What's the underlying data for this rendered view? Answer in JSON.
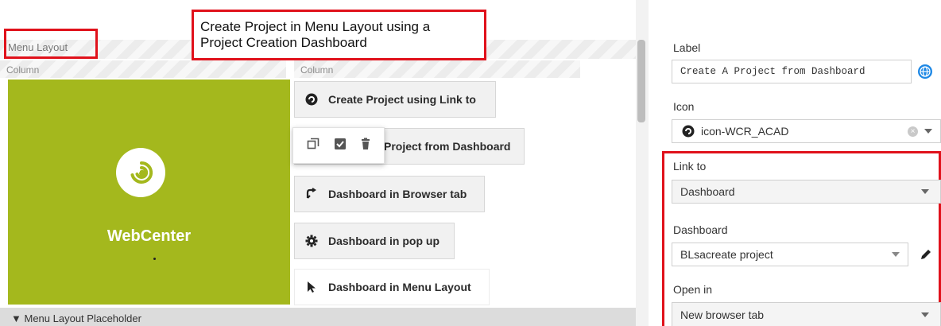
{
  "annotation": {
    "menu_layout_box_label": "Menu Layout",
    "title_line1": "Create Project in Menu Layout using a",
    "title_line2": "Project Creation Dashboard"
  },
  "editor": {
    "section_title": "Menu Layout",
    "column_left": "Column",
    "column_right": "Column",
    "brand": "WebCenter",
    "brand_color": "#a4b81d",
    "placeholder": "Menu Layout Placeholder"
  },
  "menu_buttons": [
    {
      "label": "Create Project using Link to",
      "icon": "create-project-icon"
    },
    {
      "label": "Project from Dashboard",
      "icon": "dashboard-icon"
    },
    {
      "label": "Dashboard in Browser tab",
      "icon": "open-browser-icon"
    },
    {
      "label": "Dashboard in pop up",
      "icon": "gear-icon"
    },
    {
      "label": "Dashboard in Menu Layout",
      "icon": "cursor-arrow-icon"
    }
  ],
  "toolbar_popup": {
    "icons": [
      "copy-icon",
      "checkbox-icon",
      "delete-icon"
    ]
  },
  "properties": {
    "label_title": "Label",
    "label_value": "Create A Project from Dashboard",
    "icon_title": "Icon",
    "icon_value": "icon-WCR_ACAD",
    "link_to_title": "Link to",
    "link_to_value": "Dashboard",
    "dashboard_title": "Dashboard",
    "dashboard_value": "BLsacreate project",
    "open_in_title": "Open in",
    "open_in_value": "New browser tab"
  },
  "colors": {
    "annotation_red": "#e0111b",
    "globe_blue": "#1e88e5"
  }
}
